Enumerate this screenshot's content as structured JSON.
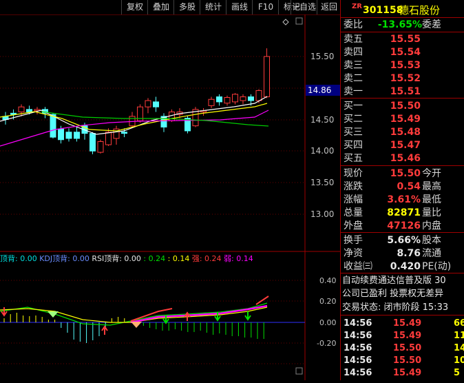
{
  "toolbar": {
    "items": [
      "复权",
      "叠加",
      "多股",
      "统计",
      "画线",
      "F10",
      "标记",
      "+自选",
      "返回"
    ]
  },
  "chart": {
    "price_axis": [
      "15.50",
      "15.00",
      "14.50",
      "14.00",
      "13.50",
      "13.00"
    ],
    "current_price_tag": "14.86",
    "indicator_axis": [
      "0.40",
      "0.20",
      "0.00",
      "-0.20"
    ],
    "indicator_legend": {
      "part1_label": "顶背: ",
      "part1_value": "0.00",
      "part2_label": " KDJ顶背: ",
      "part2_value": "0.00",
      "part3_label": " RSI顶背: ",
      "part3_value": "0.00",
      "part4_value": " : 0.24",
      "part5_value": " : 0.14",
      "part6_label": " 强: ",
      "part6_value": "0.24",
      "part7_label": " 弱: ",
      "part7_value": "0.14"
    },
    "colors": {
      "up": "#ff3b3b",
      "down": "#54ffff",
      "ma5": "#ffffff",
      "ma10": "#ffff00",
      "ma20": "#ff00ff",
      "ma60": "#00cc00"
    }
  },
  "quote": {
    "code_prefix": "ZR",
    "code": "301158",
    "name": "德石股份",
    "ratio": {
      "label": "委比",
      "value": "-13.65%",
      "label2": "委差"
    },
    "asks": [
      {
        "label": "卖五",
        "price": "15.55"
      },
      {
        "label": "卖四",
        "price": "15.54"
      },
      {
        "label": "卖三",
        "price": "15.53"
      },
      {
        "label": "卖二",
        "price": "15.52"
      },
      {
        "label": "卖一",
        "price": "15.51"
      }
    ],
    "bids": [
      {
        "label": "买一",
        "price": "15.50"
      },
      {
        "label": "买二",
        "price": "15.49"
      },
      {
        "label": "买三",
        "price": "15.48"
      },
      {
        "label": "买四",
        "price": "15.47"
      },
      {
        "label": "买五",
        "price": "15.46"
      }
    ],
    "stats": [
      {
        "label": "现价",
        "value": "15.50",
        "label2": "今开"
      },
      {
        "label": "涨跌",
        "value": "0.54",
        "label2": "最高"
      },
      {
        "label": "涨幅",
        "value": "3.61%",
        "label2": "最低"
      },
      {
        "label": "总量",
        "value": "82871",
        "label2": "量比"
      },
      {
        "label": "外盘",
        "value": "47126",
        "label2": "内盘"
      }
    ],
    "fund": [
      {
        "label": "换手",
        "value": "5.66%",
        "label2": "股本"
      },
      {
        "label": "净资",
        "value": "8.76",
        "label2": "流通"
      },
      {
        "label": "收益㈢",
        "value": "0.420",
        "label2": "PE(动)"
      }
    ],
    "notice1": "自动续费通达信普及版  30",
    "notice2": "公司已盈利 投票权无差异",
    "status": "交易状态: 闭市阶段 15:33",
    "ticks": [
      {
        "time": "14:56",
        "price": "15.49",
        "vol": "66"
      },
      {
        "time": "14:56",
        "price": "15.49",
        "vol": "11"
      },
      {
        "time": "14:56",
        "price": "15.50",
        "vol": "14"
      },
      {
        "time": "14:56",
        "price": "15.50",
        "vol": "10"
      },
      {
        "time": "14:56",
        "price": "15.49",
        "vol": "5"
      }
    ]
  }
}
